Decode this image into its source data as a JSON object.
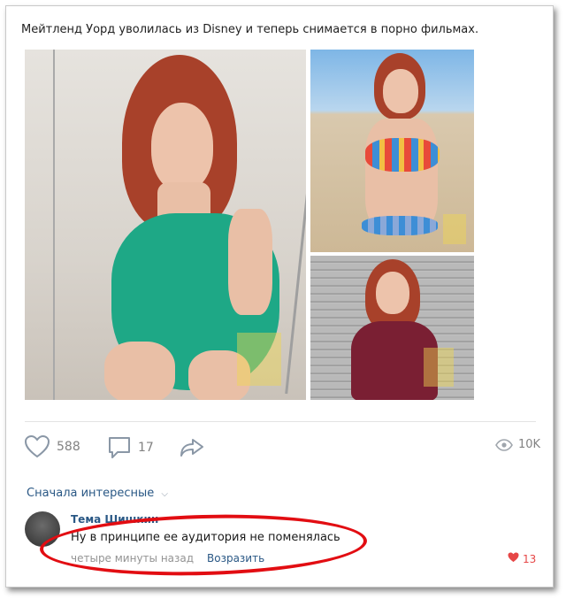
{
  "post": {
    "text": "Мейтленд Уорд уволилась из Disney и теперь снимается в порно фильмах."
  },
  "photos": [
    {
      "name": "photo-green-bodysuit"
    },
    {
      "name": "photo-bikini"
    },
    {
      "name": "photo-burgundy-shirt"
    }
  ],
  "actions": {
    "likes": "588",
    "comments": "17",
    "views": "10K"
  },
  "comments_section": {
    "sort_label": "Сначала интересные",
    "comment": {
      "author": "Тема Шишкин",
      "text": "Ну в принципе ее аудитория не поменялась",
      "time": "четыре минуты назад",
      "reply_label": "Возразить",
      "likes": "13"
    }
  },
  "colors": {
    "link": "#2a5885",
    "muted": "#828282",
    "highlight": "#e20d12",
    "like_active": "#e64646"
  }
}
